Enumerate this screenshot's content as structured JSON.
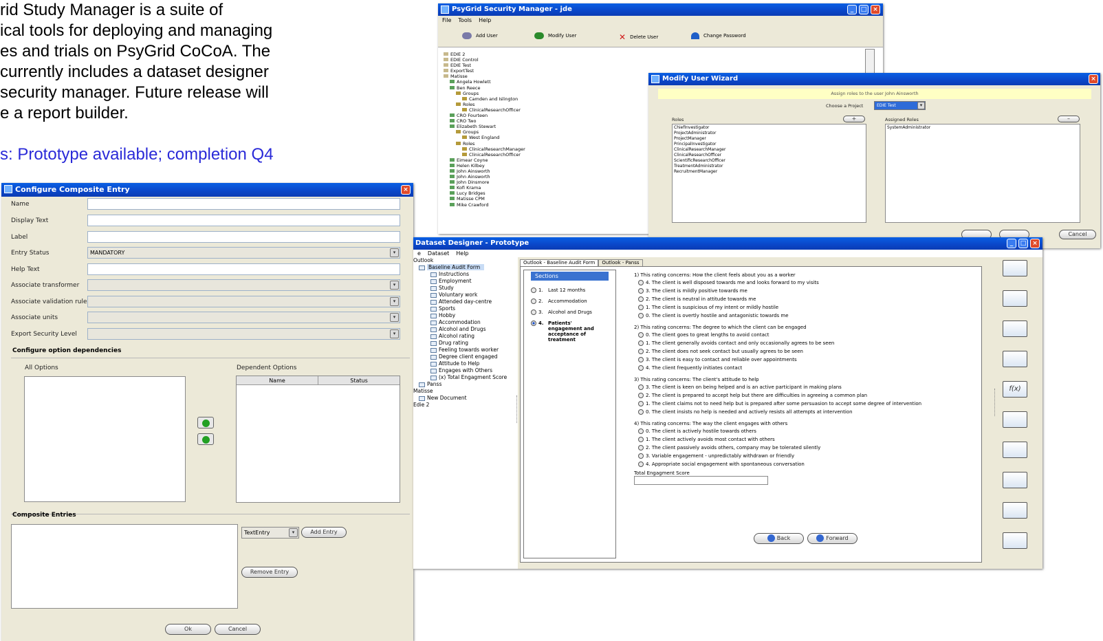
{
  "description": {
    "lines": [
      "rid Study Manager is a suite of",
      "ical tools for deploying and managing",
      "es and trials on PsyGrid CoCoA. The",
      "currently includes a dataset designer",
      "security manager. Future release will",
      "e a report builder.",
      ""
    ],
    "status": "s: Prototype available; completion Q4"
  },
  "security_manager": {
    "title": "PsyGrid Security Manager - jde",
    "menu": [
      "File",
      "Tools",
      "Help"
    ],
    "toolbar": [
      "Add User",
      "Modify User",
      "Delete User",
      "Change Password"
    ],
    "tree": [
      {
        "text": "EDIE 2",
        "level": 0
      },
      {
        "text": "EDIE Control",
        "level": 0
      },
      {
        "text": "EDIE Test",
        "level": 0
      },
      {
        "text": "ExportTest",
        "level": 0
      },
      {
        "text": "Matisse",
        "level": 0
      },
      {
        "text": "Angela Howlett",
        "level": 1
      },
      {
        "text": "Ben Reece",
        "level": 1
      },
      {
        "text": "Groups",
        "level": 2
      },
      {
        "text": "Camden and Islington",
        "level": 3
      },
      {
        "text": "Roles",
        "level": 2
      },
      {
        "text": "ClinicalResearchOfficer",
        "level": 3
      },
      {
        "text": "CRO Fourteen",
        "level": 1
      },
      {
        "text": "CRO Two",
        "level": 1
      },
      {
        "text": "Elizabeth Stewart",
        "level": 1
      },
      {
        "text": "Groups",
        "level": 2
      },
      {
        "text": "West England",
        "level": 3
      },
      {
        "text": "Roles",
        "level": 2
      },
      {
        "text": "ClinicalResearchManager",
        "level": 3
      },
      {
        "text": "ClinicalResearchOfficer",
        "level": 3
      },
      {
        "text": "Eimear Coyne",
        "level": 1
      },
      {
        "text": "Helen Kilbey",
        "level": 1
      },
      {
        "text": "John Ainsworth",
        "level": 1
      },
      {
        "text": "John Ainsworth",
        "level": 1
      },
      {
        "text": "John Dinsmore",
        "level": 1
      },
      {
        "text": "Kofi Krama",
        "level": 1
      },
      {
        "text": "Lucy Bridges",
        "level": 1
      },
      {
        "text": "Matisse CPM",
        "level": 1
      },
      {
        "text": "Mike Crawford",
        "level": 1
      }
    ]
  },
  "modify_user_wizard": {
    "title": "Modify User Wizard",
    "banner": "Assign roles to the user John Ainsworth",
    "choose_project_label": "Choose a Project",
    "project": "EDIE Test",
    "roles_label": "Roles",
    "assigned_label": "Assigned Roles",
    "add_role_btn": "+",
    "remove_role_btn": "–",
    "roles": [
      "ChiefInvestigator",
      "ProjectAdministrator",
      "ProjectManager",
      "PrincipalInvestigator",
      "ClinicalResearchManager",
      "ClinicalResearchOfficer",
      "ScientificResearchOfficer",
      "TreatmentAdministrator",
      "RecruitmentManager"
    ],
    "assigned_roles": [
      "SystemAdministrator"
    ],
    "cancel": "Cancel"
  },
  "composite": {
    "title": "Configure Composite Entry",
    "fields": [
      {
        "label": "Name",
        "value": "",
        "type": "text"
      },
      {
        "label": "Display Text",
        "value": "",
        "type": "text"
      },
      {
        "label": "Label",
        "value": "",
        "type": "text"
      },
      {
        "label": "Entry Status",
        "value": "MANDATORY",
        "type": "select"
      },
      {
        "label": "Help Text",
        "value": "",
        "type": "text"
      },
      {
        "label": "Associate transformer",
        "value": "",
        "type": "select"
      },
      {
        "label": "Associate validation rule",
        "value": "",
        "type": "select"
      },
      {
        "label": "Associate units",
        "value": "",
        "type": "select"
      },
      {
        "label": "Export Security Level",
        "value": "",
        "type": "select"
      }
    ],
    "dependencies_heading": "Configure option dependencies",
    "all_options_label": "All Options",
    "dependent_options_label": "Dependent Options",
    "dep_columns": [
      "Name",
      "Status"
    ],
    "entries_heading": "Composite Entries",
    "entry_type": "TextEntry",
    "add_entry": "Add Entry",
    "remove_entry": "Remove Entry",
    "ok": "Ok",
    "cancel": "Cancel"
  },
  "designer": {
    "title": "Dataset Designer - Prototype",
    "menu": [
      "e",
      "Dataset",
      "Help"
    ],
    "tree": [
      {
        "text": "Outlook",
        "level": 0
      },
      {
        "text": "Baseline Audit Form",
        "level": 1,
        "selected": true
      },
      {
        "text": "Instructions",
        "level": 2
      },
      {
        "text": "Employment",
        "level": 2
      },
      {
        "text": "Study",
        "level": 2
      },
      {
        "text": "Voluntary work",
        "level": 2
      },
      {
        "text": "Attended day-centre",
        "level": 2
      },
      {
        "text": "Sports",
        "level": 2
      },
      {
        "text": "Hobby",
        "level": 2
      },
      {
        "text": "Accommodation",
        "level": 2
      },
      {
        "text": "Alcohol and Drugs",
        "level": 2
      },
      {
        "text": "Alcohol rating",
        "level": 2
      },
      {
        "text": "Drug rating",
        "level": 2
      },
      {
        "text": "Feeling towards worker",
        "level": 2
      },
      {
        "text": "Degree client engaged",
        "level": 2
      },
      {
        "text": "Attitude to Help",
        "level": 2
      },
      {
        "text": "Engages with Others",
        "level": 2
      },
      {
        "text": "(x) Total Engagment Score",
        "level": 2
      },
      {
        "text": "Panss",
        "level": 1
      },
      {
        "text": "Matisse",
        "level": 0
      },
      {
        "text": "New Document",
        "level": 1
      },
      {
        "text": "Edie 2",
        "level": 0
      }
    ],
    "tabs": [
      "Outlook - Baseline Audit Form",
      "Outlook - Panss"
    ],
    "sections_heading": "Sections",
    "sections": [
      {
        "num": "1.",
        "label": "Last 12 months",
        "selected": false
      },
      {
        "num": "2.",
        "label": "Accommodation",
        "selected": false
      },
      {
        "num": "3.",
        "label": "Alcohol and Drugs",
        "selected": false
      },
      {
        "num": "4.",
        "label": "Patients' engagement and acceptance of treatment",
        "selected": true
      }
    ],
    "questions": [
      {
        "title": "1) This rating concerns: How the client feels about you as a worker",
        "options": [
          "4. The client is well disposed towards me and looks forward to my visits",
          "3. The client is mildly positive towards me",
          "2. The client is neutral in attitude towards me",
          "1. The client is suspicious of my intent or mildly hostile",
          "0. The client is overtly hostile and antagonistic towards me"
        ]
      },
      {
        "title": "2) This rating concerns: The degree to which the client can be engaged",
        "options": [
          "0. The client goes to great lengths to avoid contact",
          "1. The client generally avoids contact and only occasionally agrees to be seen",
          "2. The client does not seek contact but usually agrees to be seen",
          "3. The client is easy to contact and reliable over appointments",
          "4. The client frequently initiates contact"
        ]
      },
      {
        "title": "3) This rating concerns: The client's attitude to help",
        "options": [
          "3. The client is keen on being helped and is an active participant in making plans",
          "2. The client is prepared to accept help but there are difficulties in agreeing a common plan",
          "1. The client claims not to need help but is prepared after some persuasion to accept some degree of intervention",
          "0. The client insists no help is needed and actively resists all attempts at intervention"
        ]
      },
      {
        "title": "4) This rating concerns: The way the client engages with others",
        "options": [
          "0. The client is actively hostile towards others",
          "1. The client actively avoids most contact with others",
          "2. The client passively avoids others, company may be tolerated silently",
          "3. Variable engagement - unpredictably withdrawn or friendly",
          "4. Appropriate social engagement with spontaneous conversation"
        ]
      }
    ],
    "total_label": "Total Engagment Score",
    "back": "Back",
    "forward": "Forward",
    "palette": [
      "document-icon",
      "text-tool-icon",
      "form-icon",
      "window-icon",
      "f(x)",
      "table-icon",
      "tag-icon",
      "textfield-icon",
      "list-icon",
      "panel-icon"
    ]
  }
}
